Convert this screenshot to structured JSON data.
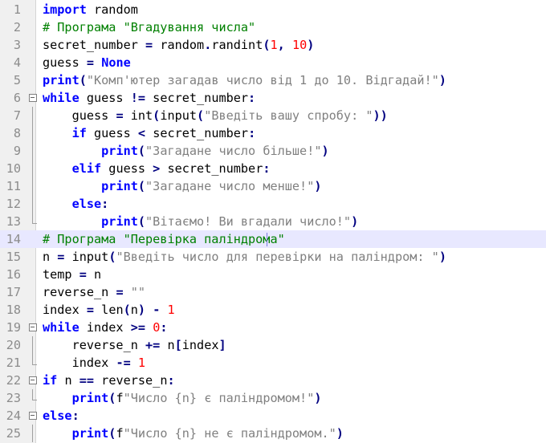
{
  "editor": {
    "colors": {
      "keyword": "#0000ff",
      "comment": "#008000",
      "string": "#808080",
      "number": "#ff0000",
      "operator": "#000080",
      "current_line": "#e8e8ff"
    },
    "current_line": 14,
    "lines": [
      {
        "num": "1",
        "fold": "none",
        "tokens": [
          [
            "kw",
            "import"
          ],
          [
            "tx",
            " random"
          ]
        ]
      },
      {
        "num": "2",
        "fold": "none",
        "tokens": [
          [
            "cm",
            "# Програма \"Вгадування числа\""
          ]
        ]
      },
      {
        "num": "3",
        "fold": "none",
        "tokens": [
          [
            "tx",
            "secret_number "
          ],
          [
            "op",
            "="
          ],
          [
            "tx",
            " random"
          ],
          [
            "op",
            "."
          ],
          [
            "tx",
            "randint"
          ],
          [
            "op",
            "("
          ],
          [
            "nm",
            "1"
          ],
          [
            "op",
            ","
          ],
          [
            "tx",
            " "
          ],
          [
            "nm",
            "10"
          ],
          [
            "op",
            ")"
          ]
        ]
      },
      {
        "num": "4",
        "fold": "none",
        "tokens": [
          [
            "tx",
            "guess "
          ],
          [
            "op",
            "="
          ],
          [
            "tx",
            " "
          ],
          [
            "kw",
            "None"
          ]
        ]
      },
      {
        "num": "5",
        "fold": "none",
        "tokens": [
          [
            "kw",
            "print"
          ],
          [
            "op",
            "("
          ],
          [
            "st",
            "\"Комп'ютер загадав число від 1 до 10. Відгадай!\""
          ],
          [
            "op",
            ")"
          ]
        ]
      },
      {
        "num": "6",
        "fold": "box",
        "tokens": [
          [
            "kw",
            "while"
          ],
          [
            "tx",
            " guess "
          ],
          [
            "op",
            "!="
          ],
          [
            "tx",
            " secret_number"
          ],
          [
            "op",
            ":"
          ]
        ]
      },
      {
        "num": "7",
        "fold": "line",
        "tokens": [
          [
            "tx",
            "    guess "
          ],
          [
            "op",
            "="
          ],
          [
            "tx",
            " int"
          ],
          [
            "op",
            "("
          ],
          [
            "tx",
            "input"
          ],
          [
            "op",
            "("
          ],
          [
            "st",
            "\"Введіть вашу спробу: \""
          ],
          [
            "op",
            "))"
          ]
        ]
      },
      {
        "num": "8",
        "fold": "line",
        "tokens": [
          [
            "tx",
            "    "
          ],
          [
            "kw",
            "if"
          ],
          [
            "tx",
            " guess "
          ],
          [
            "op",
            "<"
          ],
          [
            "tx",
            " secret_number"
          ],
          [
            "op",
            ":"
          ]
        ]
      },
      {
        "num": "9",
        "fold": "line",
        "tokens": [
          [
            "tx",
            "        "
          ],
          [
            "kw",
            "print"
          ],
          [
            "op",
            "("
          ],
          [
            "st",
            "\"Загадане число більше!\""
          ],
          [
            "op",
            ")"
          ]
        ]
      },
      {
        "num": "10",
        "fold": "line",
        "tokens": [
          [
            "tx",
            "    "
          ],
          [
            "kw",
            "elif"
          ],
          [
            "tx",
            " guess "
          ],
          [
            "op",
            ">"
          ],
          [
            "tx",
            " secret_number"
          ],
          [
            "op",
            ":"
          ]
        ]
      },
      {
        "num": "11",
        "fold": "line",
        "tokens": [
          [
            "tx",
            "        "
          ],
          [
            "kw",
            "print"
          ],
          [
            "op",
            "("
          ],
          [
            "st",
            "\"Загадане число менше!\""
          ],
          [
            "op",
            ")"
          ]
        ]
      },
      {
        "num": "12",
        "fold": "line",
        "tokens": [
          [
            "tx",
            "    "
          ],
          [
            "kw",
            "else"
          ],
          [
            "op",
            ":"
          ]
        ]
      },
      {
        "num": "13",
        "fold": "end",
        "tokens": [
          [
            "tx",
            "        "
          ],
          [
            "kw",
            "print"
          ],
          [
            "op",
            "("
          ],
          [
            "st",
            "\"Вітаємо! Ви вгадали число!\""
          ],
          [
            "op",
            ")"
          ]
        ]
      },
      {
        "num": "14",
        "fold": "none",
        "tokens": [
          [
            "cm",
            "# Програма \"Перевірка паліндрома\""
          ]
        ]
      },
      {
        "num": "15",
        "fold": "none",
        "tokens": [
          [
            "tx",
            "n "
          ],
          [
            "op",
            "="
          ],
          [
            "tx",
            " input"
          ],
          [
            "op",
            "("
          ],
          [
            "st",
            "\"Введіть число для перевірки на паліндром: \""
          ],
          [
            "op",
            ")"
          ]
        ]
      },
      {
        "num": "16",
        "fold": "none",
        "tokens": [
          [
            "tx",
            "temp "
          ],
          [
            "op",
            "="
          ],
          [
            "tx",
            " n"
          ]
        ]
      },
      {
        "num": "17",
        "fold": "none",
        "tokens": [
          [
            "tx",
            "reverse_n "
          ],
          [
            "op",
            "="
          ],
          [
            "tx",
            " "
          ],
          [
            "st",
            "\"\""
          ]
        ]
      },
      {
        "num": "18",
        "fold": "none",
        "tokens": [
          [
            "tx",
            "index "
          ],
          [
            "op",
            "="
          ],
          [
            "tx",
            " len"
          ],
          [
            "op",
            "("
          ],
          [
            "tx",
            "n"
          ],
          [
            "op",
            ")"
          ],
          [
            "tx",
            " "
          ],
          [
            "op",
            "-"
          ],
          [
            "tx",
            " "
          ],
          [
            "nm",
            "1"
          ]
        ]
      },
      {
        "num": "19",
        "fold": "box",
        "tokens": [
          [
            "kw",
            "while"
          ],
          [
            "tx",
            " index "
          ],
          [
            "op",
            ">="
          ],
          [
            "tx",
            " "
          ],
          [
            "nm",
            "0"
          ],
          [
            "op",
            ":"
          ]
        ]
      },
      {
        "num": "20",
        "fold": "line",
        "tokens": [
          [
            "tx",
            "    reverse_n "
          ],
          [
            "op",
            "+="
          ],
          [
            "tx",
            " n"
          ],
          [
            "op",
            "["
          ],
          [
            "tx",
            "index"
          ],
          [
            "op",
            "]"
          ]
        ]
      },
      {
        "num": "21",
        "fold": "end",
        "tokens": [
          [
            "tx",
            "    index "
          ],
          [
            "op",
            "-="
          ],
          [
            "tx",
            " "
          ],
          [
            "nm",
            "1"
          ]
        ]
      },
      {
        "num": "22",
        "fold": "box",
        "tokens": [
          [
            "kw",
            "if"
          ],
          [
            "tx",
            " n "
          ],
          [
            "op",
            "=="
          ],
          [
            "tx",
            " reverse_n"
          ],
          [
            "op",
            ":"
          ]
        ]
      },
      {
        "num": "23",
        "fold": "end",
        "tokens": [
          [
            "tx",
            "    "
          ],
          [
            "kw",
            "print"
          ],
          [
            "op",
            "("
          ],
          [
            "tx",
            "f"
          ],
          [
            "st",
            "\"Число {n} є паліндромом!\""
          ],
          [
            "op",
            ")"
          ]
        ]
      },
      {
        "num": "24",
        "fold": "box",
        "tokens": [
          [
            "kw",
            "else"
          ],
          [
            "op",
            ":"
          ]
        ]
      },
      {
        "num": "25",
        "fold": "line",
        "tokens": [
          [
            "tx",
            "    "
          ],
          [
            "kw",
            "print"
          ],
          [
            "op",
            "("
          ],
          [
            "tx",
            "f"
          ],
          [
            "st",
            "\"Число {n} не є паліндромом.\""
          ],
          [
            "op",
            ")"
          ]
        ]
      }
    ]
  }
}
